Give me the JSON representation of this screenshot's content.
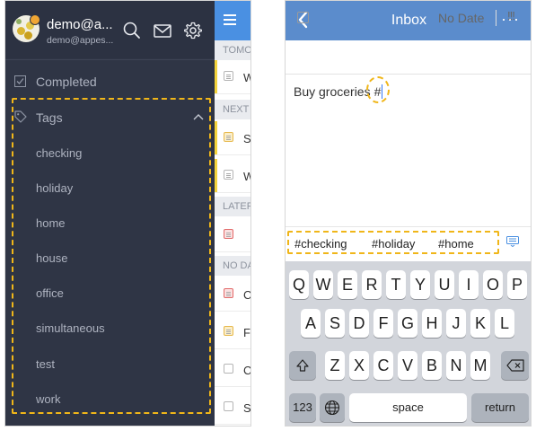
{
  "left_panel": {
    "user": {
      "name": "demo@a...",
      "email": "demo@appes..."
    },
    "header_icons": [
      "search-icon",
      "mail-icon",
      "gear-icon"
    ],
    "completed_label": "Completed",
    "tags_label": "Tags",
    "tags": [
      "checking",
      "holiday",
      "home",
      "house",
      "office",
      "simultaneous",
      "test",
      "work"
    ],
    "task_list": {
      "sections": [
        "TOMORROW",
        "NEXT 7 DAYS",
        "LATER",
        "NO DATE"
      ],
      "items": [
        "W",
        "S",
        "W",
        "C",
        "F",
        "C",
        "S"
      ]
    }
  },
  "right_panel": {
    "nav": {
      "title": "Inbox",
      "more": "···"
    },
    "options": {
      "date": "No Date",
      "priority": "!!!"
    },
    "editor_text": "Buy groceries",
    "hash": "#",
    "suggestions": [
      "#checking",
      "#holiday",
      "#home"
    ],
    "keyboard": {
      "row1": [
        "Q",
        "W",
        "E",
        "R",
        "T",
        "Y",
        "U",
        "I",
        "O",
        "P"
      ],
      "row2": [
        "A",
        "S",
        "D",
        "F",
        "G",
        "H",
        "J",
        "K",
        "L"
      ],
      "row3": [
        "Z",
        "X",
        "C",
        "V",
        "B",
        "N",
        "M"
      ],
      "numbers_key": "123",
      "space_key": "space",
      "return_key": "return"
    }
  },
  "colors": {
    "drawer_bg": "#2f3545",
    "highlight": "#f0b619",
    "nav_bg": "#5b8ccc",
    "list_header": "#4a90e2"
  }
}
